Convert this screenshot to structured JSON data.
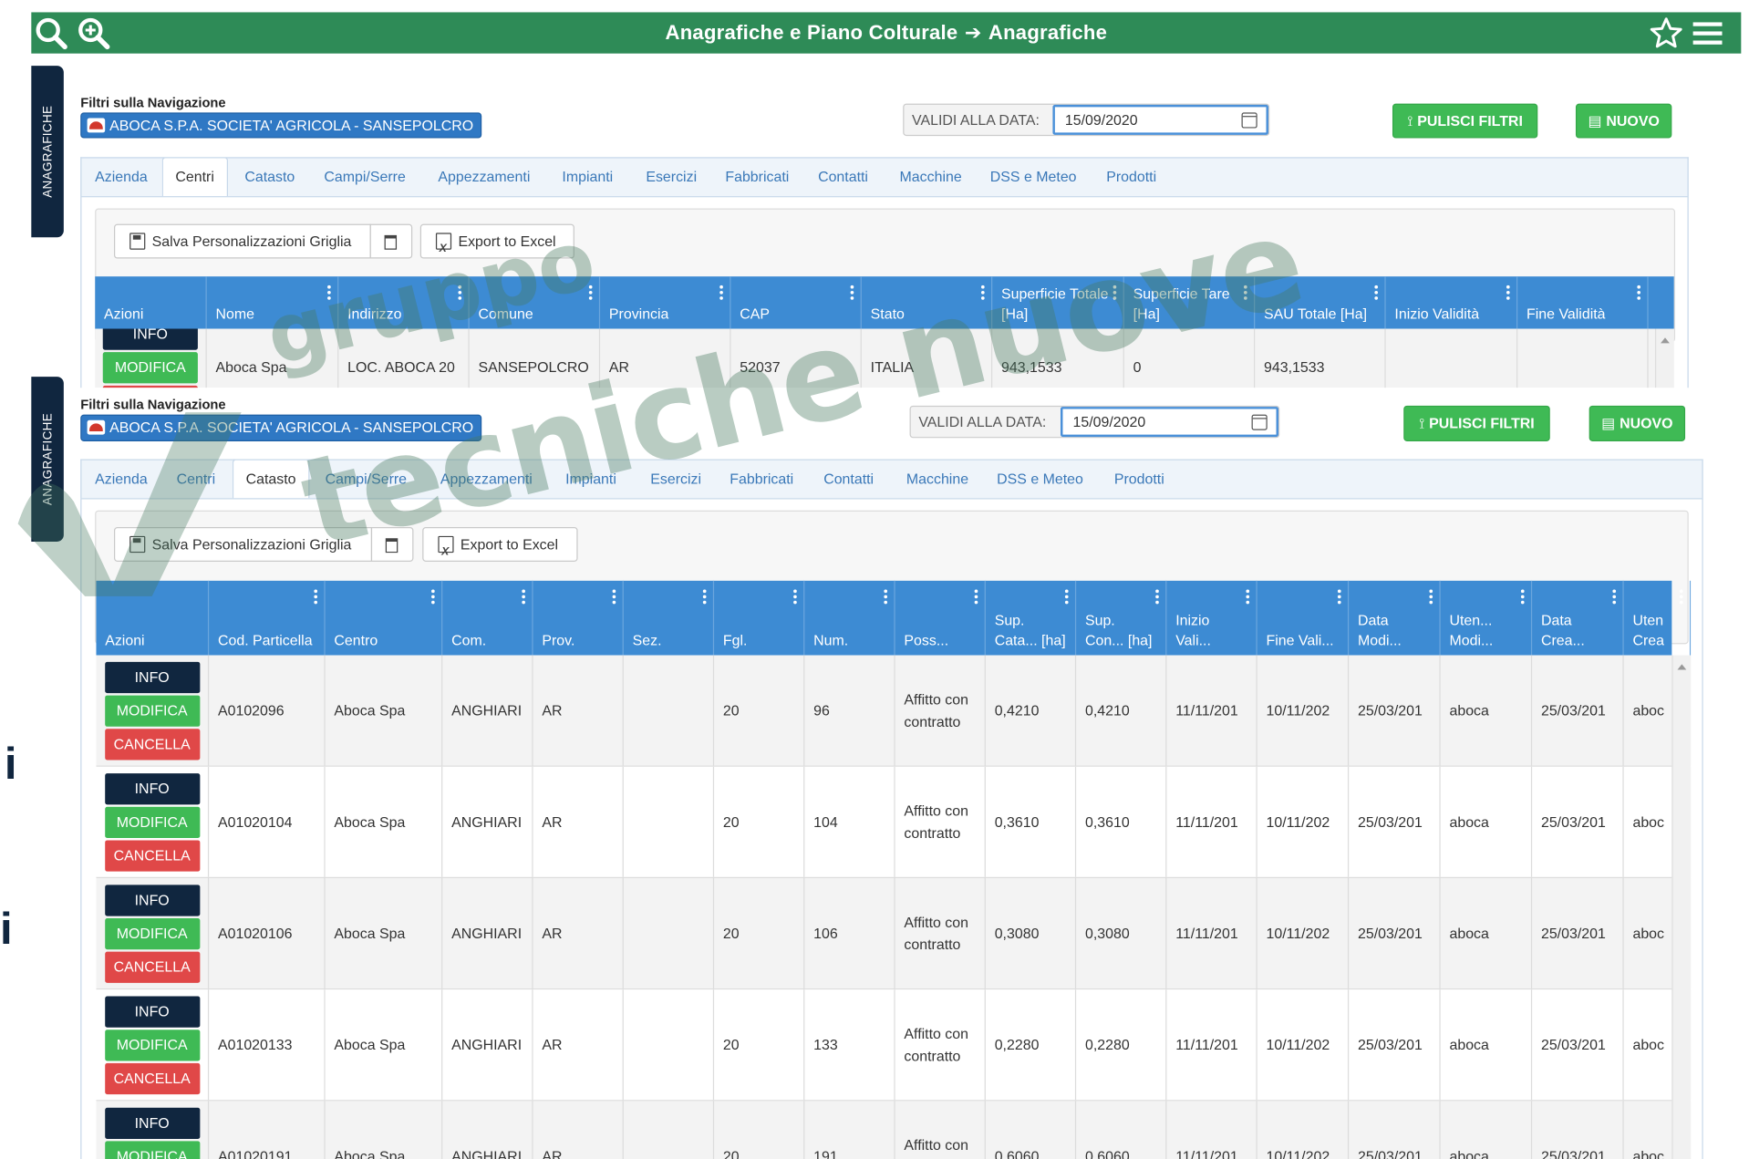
{
  "header": {
    "breadcrumb_parent": "Anagrafiche e Piano Colturale",
    "breadcrumb_current": "Anagrafiche",
    "icons": [
      "search-icon",
      "zoom-in-icon",
      "star-icon",
      "menu-icon"
    ]
  },
  "side_tab": {
    "label": "ANAGRAFICHE"
  },
  "filters": {
    "label": "Filtri sulla Navigazione",
    "company": "ABOCA S.P.A. SOCIETA' AGRICOLA - SANSEPOLCRO",
    "date_label": "VALIDI ALLA DATA:",
    "date_value": "15/09/2020",
    "clear_button": "PULISCI FILTRI",
    "new_button": "NUOVO"
  },
  "tabs": [
    "Azienda",
    "Centri",
    "Catasto",
    "Campi/Serre",
    "Appezzamenti",
    "Impianti",
    "Esercizi",
    "Fabbricati",
    "Contatti",
    "Macchine",
    "DSS e Meteo",
    "Prodotti"
  ],
  "toolbar": {
    "save_grid": "Salva Personalizzazioni Griglia",
    "export": "Export to Excel"
  },
  "actions": {
    "info": "INFO",
    "modify": "MODIFICA",
    "delete": "CANCELLA"
  },
  "centri_grid": {
    "active_tab": "Centri",
    "headers": [
      "Azioni",
      "Nome",
      "Indirizzo",
      "Comune",
      "Provincia",
      "CAP",
      "Stato",
      "Superficie Totale [Ha]",
      "Superficie Tare [Ha]",
      "SAU Totale [Ha]",
      "Inizio Validità",
      "Fine Validità"
    ],
    "rows": [
      [
        "",
        "Aboca Spa",
        "LOC. ABOCA 20",
        "SANSEPOLCRO",
        "AR",
        "52037",
        "ITALIA",
        "943,1533",
        "0",
        "943,1533",
        "",
        ""
      ]
    ]
  },
  "catasto_grid": {
    "active_tab": "Catasto",
    "headers": [
      "Azioni",
      "Cod. Particella",
      "Centro",
      "Com.",
      "Prov.",
      "Sez.",
      "Fgl.",
      "Num.",
      "Poss...",
      "Sup. Cata... [ha]",
      "Sup. Con... [ha]",
      "Inizio Vali...",
      "Fine Vali...",
      "Data Modi...",
      "Uten... Modi...",
      "Data Crea...",
      "Uten Crea"
    ],
    "rows": [
      [
        "",
        "A0102096",
        "Aboca Spa",
        "ANGHIARI",
        "AR",
        "",
        "20",
        "96",
        "Affitto con contratto",
        "0,4210",
        "0,4210",
        "11/11/201",
        "10/11/202",
        "25/03/201",
        "aboca",
        "25/03/201",
        "aboc"
      ],
      [
        "",
        "A01020104",
        "Aboca Spa",
        "ANGHIARI",
        "AR",
        "",
        "20",
        "104",
        "Affitto con contratto",
        "0,3610",
        "0,3610",
        "11/11/201",
        "10/11/202",
        "25/03/201",
        "aboca",
        "25/03/201",
        "aboc"
      ],
      [
        "",
        "A01020106",
        "Aboca Spa",
        "ANGHIARI",
        "AR",
        "",
        "20",
        "106",
        "Affitto con contratto",
        "0,3080",
        "0,3080",
        "11/11/201",
        "10/11/202",
        "25/03/201",
        "aboca",
        "25/03/201",
        "aboc"
      ],
      [
        "",
        "A01020133",
        "Aboca Spa",
        "ANGHIARI",
        "AR",
        "",
        "20",
        "133",
        "Affitto con contratto",
        "0,2280",
        "0,2280",
        "11/11/201",
        "10/11/202",
        "25/03/201",
        "aboca",
        "25/03/201",
        "aboc"
      ],
      [
        "",
        "A01020191",
        "Aboca Spa",
        "ANGHIARI",
        "AR",
        "",
        "20",
        "191",
        "Affitto con contratto",
        "0,6060",
        "0,6060",
        "11/11/201",
        "10/11/202",
        "25/03/201",
        "aboca",
        "25/03/201",
        "aboc"
      ]
    ]
  },
  "watermark": {
    "line1": "gruppo",
    "line2": "tecniche nuove"
  },
  "side_fragments": [
    "i",
    "i"
  ],
  "colors": {
    "header_green": "#2e8b57",
    "grid_header_blue": "#3d8bd3",
    "chip_blue": "#2f78c4",
    "navy": "#10263f",
    "button_green": "#3fba55",
    "button_red": "#e04848"
  }
}
